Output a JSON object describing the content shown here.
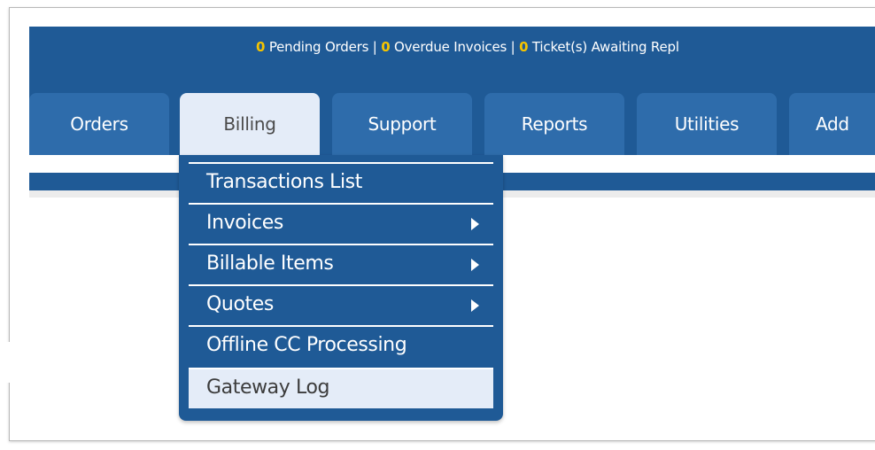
{
  "header": {
    "stats": [
      {
        "count": "0",
        "label": " Pending Orders"
      },
      {
        "count": "0",
        "label": " Overdue Invoices"
      },
      {
        "count": "0",
        "label": " Ticket(s) Awaiting Repl"
      }
    ],
    "separator": " | "
  },
  "nav": {
    "tabs": [
      {
        "label": "Orders"
      },
      {
        "label": "Billing",
        "active": true
      },
      {
        "label": "Support"
      },
      {
        "label": "Reports"
      },
      {
        "label": "Utilities"
      },
      {
        "label": "Add"
      }
    ]
  },
  "billing_menu": {
    "items": [
      {
        "label": "Transactions List",
        "submenu": false
      },
      {
        "label": "Invoices",
        "submenu": true
      },
      {
        "label": "Billable Items",
        "submenu": true
      },
      {
        "label": "Quotes",
        "submenu": true
      },
      {
        "label": "Offline CC Processing",
        "submenu": false
      },
      {
        "label": "Gateway Log",
        "submenu": false,
        "highlighted": true
      }
    ]
  },
  "colors": {
    "nav_background": "#1f5a96",
    "tab": "#2e6cab",
    "active_tab": "#e4ecf8",
    "count_highlight": "#f5c400"
  }
}
